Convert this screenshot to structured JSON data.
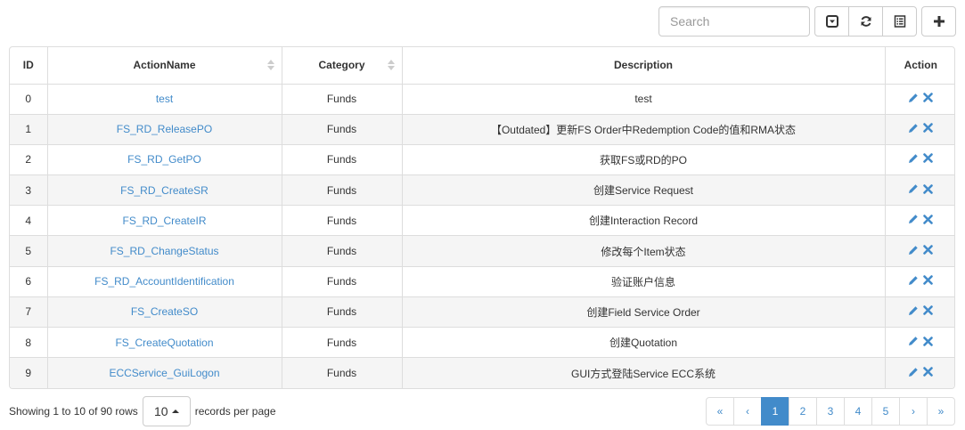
{
  "toolbar": {
    "search_placeholder": "Search",
    "buttons": [
      {
        "name": "toggle-view-button",
        "icon": "caret-square-icon"
      },
      {
        "name": "refresh-button",
        "icon": "refresh-icon"
      },
      {
        "name": "columns-button",
        "icon": "list-icon"
      },
      {
        "name": "add-button",
        "icon": "plus-icon"
      }
    ]
  },
  "table": {
    "headers": [
      "ID",
      "ActionName",
      "Category",
      "Description",
      "Action"
    ],
    "rows": [
      {
        "id": "0",
        "name": "test",
        "category": "Funds",
        "description": "test"
      },
      {
        "id": "1",
        "name": "FS_RD_ReleasePO",
        "category": "Funds",
        "description": "【Outdated】更新FS Order中Redemption Code的值和RMA状态"
      },
      {
        "id": "2",
        "name": "FS_RD_GetPO",
        "category": "Funds",
        "description": "获取FS或RD的PO"
      },
      {
        "id": "3",
        "name": "FS_RD_CreateSR",
        "category": "Funds",
        "description": "创建Service Request"
      },
      {
        "id": "4",
        "name": "FS_RD_CreateIR",
        "category": "Funds",
        "description": "创建Interaction Record"
      },
      {
        "id": "5",
        "name": "FS_RD_ChangeStatus",
        "category": "Funds",
        "description": "修改每个Item状态"
      },
      {
        "id": "6",
        "name": "FS_RD_AccountIdentification",
        "category": "Funds",
        "description": "验证账户信息"
      },
      {
        "id": "7",
        "name": "FS_CreateSO",
        "category": "Funds",
        "description": "创建Field Service Order"
      },
      {
        "id": "8",
        "name": "FS_CreateQuotation",
        "category": "Funds",
        "description": "创建Quotation"
      },
      {
        "id": "9",
        "name": "ECCService_GuiLogon",
        "category": "Funds",
        "description": "GUI方式登陆Service ECC系统"
      }
    ]
  },
  "footer": {
    "showing": "Showing 1 to 10 of 90 rows",
    "per_page_value": "10",
    "records_per_page": "records per page",
    "pages": [
      "«",
      "‹",
      "1",
      "2",
      "3",
      "4",
      "5",
      "›",
      "»"
    ],
    "active_page": "1"
  },
  "colors": {
    "link": "#428bca",
    "active_page_bg": "#428bca",
    "stripe": "#f5f5f5",
    "border": "#dddddd"
  }
}
